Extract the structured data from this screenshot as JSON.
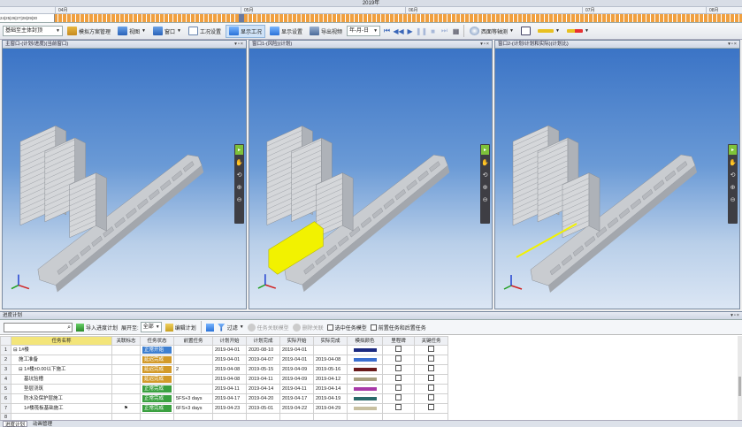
{
  "timeline": {
    "year": "2019年",
    "months": [
      "04月",
      "05月",
      "06月",
      "07月",
      "08月"
    ],
    "day_numbers": "24|25|26|27|28|29|30"
  },
  "toolbar": {
    "stage_select": "基础至主体封顶",
    "buttons": {
      "plan_manage": "模拟方案管理",
      "view": "视图",
      "window": "窗口",
      "work_settings": "工况设置",
      "show_work": "显示工况",
      "display_settings": "显示设置",
      "export_video": "导出视频",
      "export_date_format": "年-月-日",
      "tile_horizontal": "西面等轴测"
    }
  },
  "viewports": [
    {
      "title": "主窗口-(计划/进度)(当前窗口)",
      "icons": [
        "cursor-icon",
        "hand-icon",
        "orbit-icon",
        "zoom-in-icon",
        "zoom-out-icon"
      ],
      "highlight": "none"
    },
    {
      "title": "窗口1-(风险)(计划)",
      "icons": [
        "cursor-icon",
        "hand-icon",
        "orbit-icon",
        "zoom-in-icon",
        "zoom-out-icon"
      ],
      "highlight": "block"
    },
    {
      "title": "窗口2-(计划/计划和实际)(计划比)",
      "icons": [
        "cursor-icon",
        "hand-icon",
        "orbit-icon",
        "zoom-in-icon",
        "zoom-out-icon"
      ],
      "highlight": "edge"
    }
  ],
  "plan_panel": {
    "title": "进度计划",
    "toolbar": {
      "search_placeholder": "",
      "import_plan": "导入进度计划",
      "expand_label": "展开至:",
      "expand_value": "全部",
      "edit_plan": "编辑计划",
      "filter": "过滤",
      "task_relate_model": "任务关联模型",
      "remove_relation": "删除关联",
      "select_task_model": "选中任务模型",
      "show_selected_and_children": "前置任务和后置任务"
    },
    "columns": [
      "",
      "任务名称",
      "关联标志",
      "任务状态",
      "前置任务",
      "计划开始",
      "计划完成",
      "实际开始",
      "实际完成",
      "模拟颜色",
      "里程碑",
      "关键任务"
    ],
    "rows": [
      {
        "n": "1",
        "name": "⊟ 1#楼",
        "indent": 0,
        "flag": "",
        "status": "正常开始",
        "status_color": "#3e7fd0",
        "pre": "",
        "ps": "2019-04-01",
        "pe": "2020-08-10",
        "as": "2019-04-01",
        "ae": "",
        "color": "#1c2a80",
        "ms": false,
        "key": false
      },
      {
        "n": "2",
        "name": "施工准备",
        "indent": 1,
        "flag": "",
        "status": "延迟完成",
        "status_color": "#d29a2a",
        "pre": "",
        "ps": "2019-04-01",
        "pe": "2019-04-07",
        "as": "2019-04-01",
        "ae": "2019-04-08",
        "color": "#3a6fd0",
        "ms": false,
        "key": false
      },
      {
        "n": "3",
        "name": "⊟ 1#楼±0.00以下施工",
        "indent": 1,
        "flag": "",
        "status": "延迟完成",
        "status_color": "#d29a2a",
        "pre": "2",
        "ps": "2019-04-08",
        "pe": "2019-05-15",
        "as": "2019-04-09",
        "ae": "2019-05-16",
        "color": "#6a1a1a",
        "ms": false,
        "key": false
      },
      {
        "n": "4",
        "name": "基坑验槽",
        "indent": 2,
        "flag": "",
        "status": "延迟完成",
        "status_color": "#d29a2a",
        "pre": "",
        "ps": "2019-04-08",
        "pe": "2019-04-11",
        "as": "2019-04-09",
        "ae": "2019-04-12",
        "color": "#a8a080",
        "ms": false,
        "key": false
      },
      {
        "n": "5",
        "name": "垫层浇筑",
        "indent": 2,
        "flag": "",
        "status": "正常完成",
        "status_color": "#3aa040",
        "pre": "",
        "ps": "2019-04-11",
        "pe": "2019-04-14",
        "as": "2019-04-11",
        "ae": "2019-04-14",
        "color": "#a83aa8",
        "ms": false,
        "key": false
      },
      {
        "n": "6",
        "name": "防水及保护层施工",
        "indent": 2,
        "flag": "",
        "status": "正常完成",
        "status_color": "#3aa040",
        "pre": "5FS+3 days",
        "ps": "2019-04-17",
        "pe": "2019-04-20",
        "as": "2019-04-17",
        "ae": "2019-04-19",
        "color": "#2a6a6a",
        "ms": false,
        "key": false
      },
      {
        "n": "7",
        "name": "1#楼筏板基础施工",
        "indent": 2,
        "flag": "⚑",
        "status": "正常完成",
        "status_color": "#3aa040",
        "pre": "6FS+3 days",
        "ps": "2019-04-23",
        "pe": "2019-05-01",
        "as": "2019-04-22",
        "ae": "2019-04-29",
        "color": "#c8c0a0",
        "ms": false,
        "key": false
      },
      {
        "n": "8",
        "name": "",
        "indent": 2,
        "flag": "",
        "status": "",
        "status_color": "#3aa040",
        "pre": "",
        "ps": "",
        "pe": "",
        "as": "",
        "ae": "",
        "color": "",
        "ms": false,
        "key": false
      }
    ]
  },
  "status_tabs": [
    "进度计划",
    "动画管理"
  ],
  "colors": {
    "accent": "#3e7fd0",
    "nav_green": "#7ec23a",
    "highlight_yellow": "#f2f200",
    "timeline_orange": "#f0a040"
  }
}
